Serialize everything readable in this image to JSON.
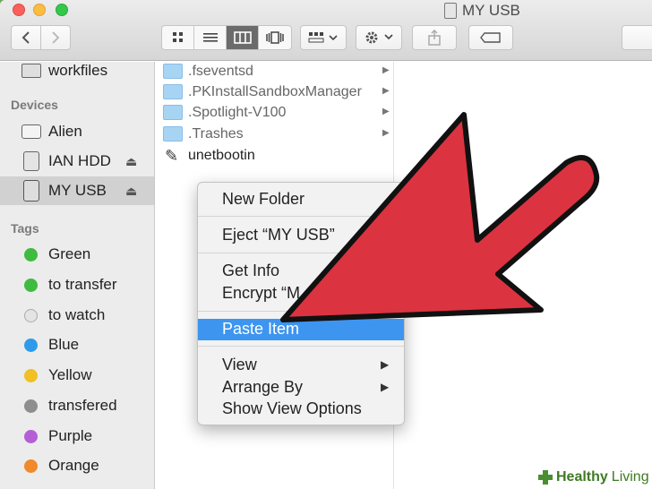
{
  "window": {
    "title": "MY USB"
  },
  "toolbar": {
    "back_icon": "chevron-left-icon",
    "forward_icon": "chevron-right-icon",
    "views": [
      "icon-view",
      "list-view",
      "column-view",
      "cover-flow-view"
    ],
    "active_view": "column-view"
  },
  "sidebar": {
    "favorites_item": "workfiles",
    "devices_header": "Devices",
    "devices": [
      {
        "label": "Alien"
      },
      {
        "label": "IAN HDD"
      },
      {
        "label": "MY USB"
      }
    ],
    "tags_header": "Tags",
    "tags": [
      {
        "label": "Green",
        "color": "#3fbb3f"
      },
      {
        "label": "to transfer",
        "color": "#3fbb3f"
      },
      {
        "label": "to watch",
        "color": "#e4e4e4"
      },
      {
        "label": "Blue",
        "color": "#2d9bea"
      },
      {
        "label": "Yellow",
        "color": "#f0c024"
      },
      {
        "label": "transfered",
        "color": "#8e8e8e"
      },
      {
        "label": "Purple",
        "color": "#b45fd6"
      },
      {
        "label": "Orange",
        "color": "#f08a2a"
      }
    ]
  },
  "files": [
    {
      "name": ".fseventsd"
    },
    {
      "name": ".PKInstallSandboxManager"
    },
    {
      "name": ".Spotlight-V100"
    },
    {
      "name": ".Trashes"
    },
    {
      "name": "unetbootin"
    }
  ],
  "context_menu": {
    "new_folder": "New Folder",
    "eject": "Eject “MY USB”",
    "get_info": "Get Info",
    "encrypt": "Encrypt “M",
    "paste_item": "Paste Item",
    "view": "View",
    "arrange_by": "Arrange By",
    "show_view_options": "Show View Options"
  },
  "overlay": {
    "arrow_color": "#dc3340"
  },
  "watermark": {
    "bold": "Healthy",
    "regular": "Living"
  }
}
